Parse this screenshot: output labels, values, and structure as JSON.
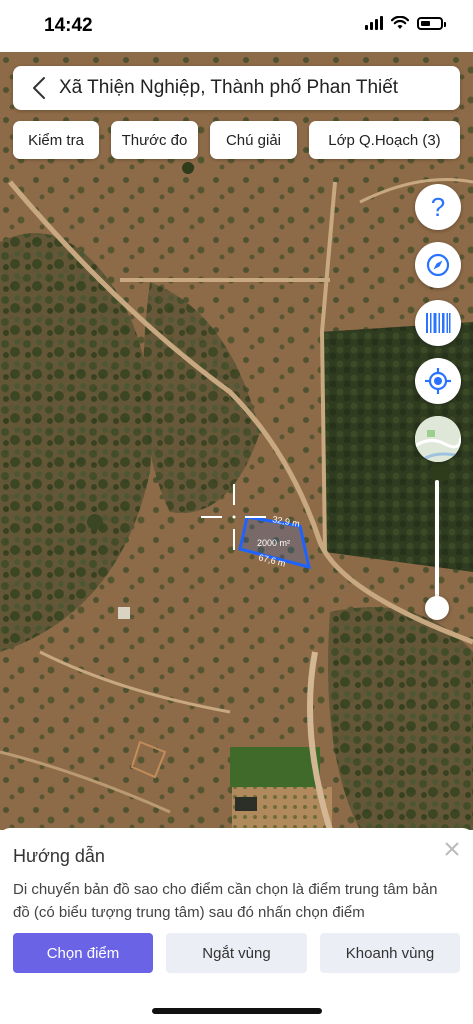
{
  "status_bar": {
    "time": "14:42"
  },
  "header": {
    "title": "Xã Thiện Nghiệp, Thành phố Phan Thiết"
  },
  "chips": [
    {
      "label": "Kiểm tra"
    },
    {
      "label": "Thước đo"
    },
    {
      "label": "Chú giải"
    },
    {
      "label": "Lớp Q.Hoạch (3)"
    }
  ],
  "map": {
    "parcel": {
      "top_edge": "32,9 m",
      "area": "2000 m²",
      "bottom_edge": "67,6 m",
      "outline_color": "#1e63ff"
    }
  },
  "controls": {
    "icons": [
      "help-icon",
      "compass-icon",
      "barcode-icon",
      "locate-icon",
      "basemap-thumbnail"
    ],
    "accent": "#2a73ff"
  },
  "panel": {
    "title": "Hướng dẫn",
    "description": "Di chuyển bản đồ sao cho điểm cần chọn là điểm trung tâm bản đồ (có biểu tượng trung tâm) sau đó nhấn chọn điểm",
    "buttons": {
      "select": "Chọn điểm",
      "break": "Ngắt vùng",
      "enclose": "Khoanh vùng"
    },
    "primary_color": "#6a63e6"
  }
}
